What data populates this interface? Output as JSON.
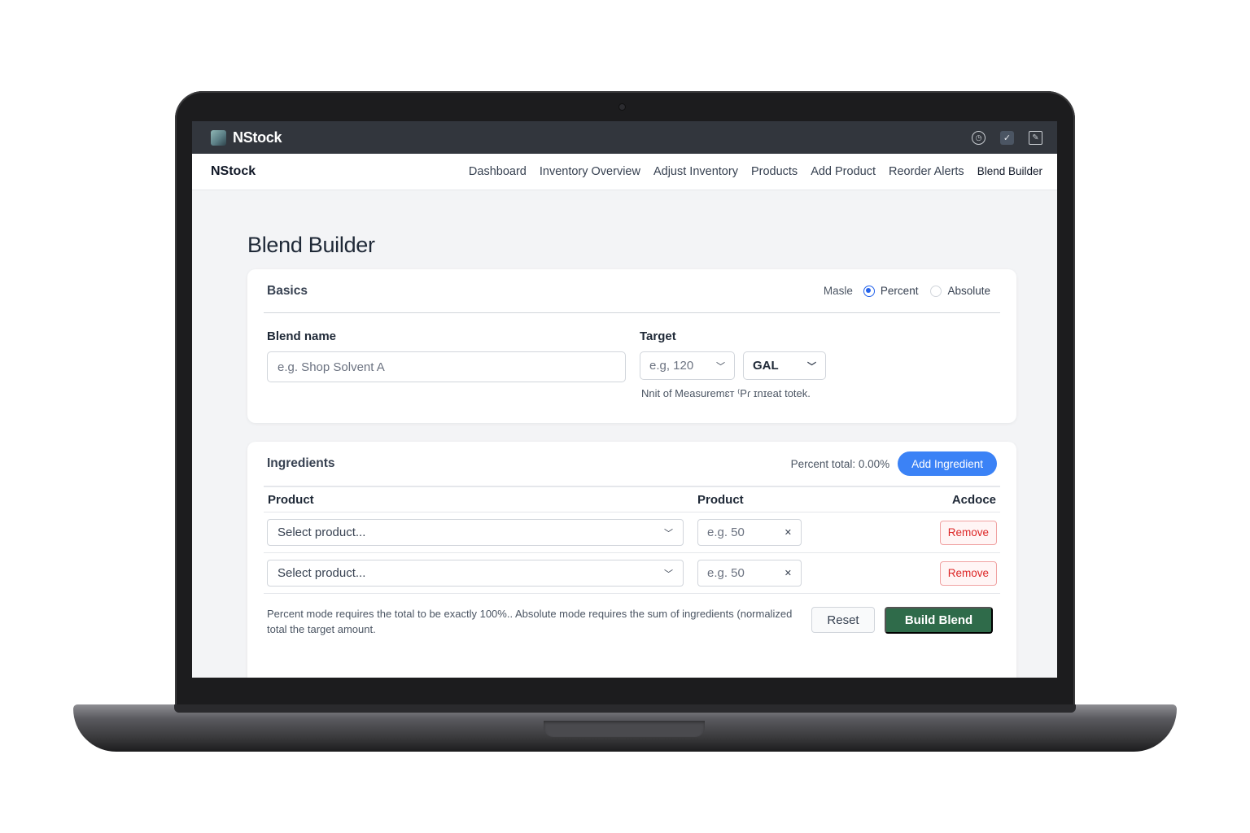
{
  "app": {
    "name": "NStock",
    "icons": [
      "clock-icon",
      "check-icon",
      "document-icon"
    ]
  },
  "nav": {
    "brand": "NStock",
    "links": [
      "Dashboard",
      "Inventory Overview",
      "Adjust Inventory",
      "Products",
      "Add Product",
      "Reorder Alerts",
      "Blend Builder"
    ],
    "active": "Blend Builder"
  },
  "page": {
    "title": "Blend Builder"
  },
  "basics": {
    "title": "Basics",
    "mode_label": "Masle",
    "mode_options": [
      "Percent",
      "Absolute"
    ],
    "mode_selected": "Percent",
    "blend_name_label": "Blend name",
    "blend_name_placeholder": "e.g. Shop Solvent A",
    "target_label": "Target",
    "target_placeholder": "e.g, 120",
    "unit_value": "GAL",
    "help_text": "Nnit of Measuremɛт ⁽Pɾ ɪnɪeat totek."
  },
  "ingredients": {
    "title": "Ingredients",
    "percent_total": "Percent total: 0.00%",
    "add_label": "Add Ingredient",
    "columns": [
      "Product",
      "Product",
      "Acdoce"
    ],
    "rows": [
      {
        "product_placeholder": "Select product...",
        "qty_placeholder": "e.g. 50",
        "remove_label": "Remove"
      },
      {
        "product_placeholder": "Select product...",
        "qty_placeholder": "e.g. 50",
        "remove_label": "Remove"
      }
    ],
    "footnote": "Percent mode requires the total to be exactly 100%.. Absolute mode requires the sum of ingredients (normalized total the target amount.",
    "reset_label": "Reset",
    "build_label": "Build Blend"
  },
  "colors": {
    "accent": "#3b82f6",
    "build_button": "#2f6b4a",
    "remove": "#dc2626",
    "titlebar": "#32363d"
  }
}
